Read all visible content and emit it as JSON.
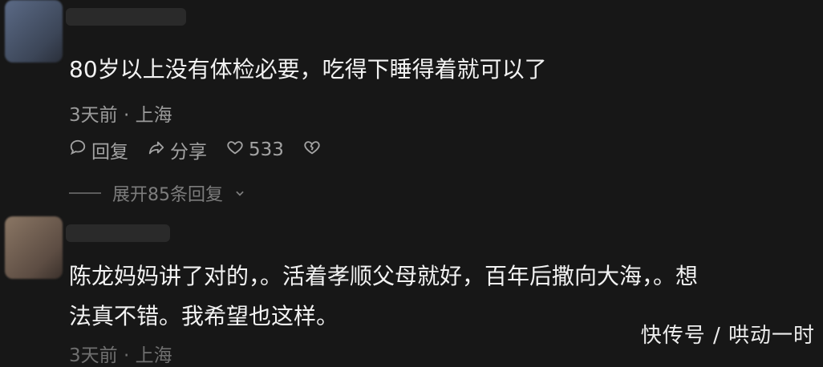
{
  "comments": [
    {
      "text": "80岁以上没有体检必要，吃得下睡得着就可以了",
      "meta": "3天前 · 上海",
      "actions": {
        "reply": "回复",
        "share": "分享",
        "likes": "533"
      },
      "expand": "展开85条回复"
    },
    {
      "text_lines": [
        "陈龙妈妈讲了对的，。活着孝顺父母就好，百年后撒向大海，。想",
        "法真不错。我希望也这样。"
      ],
      "meta_partial": "3天前 · 上海"
    }
  ],
  "watermark": "快传号 / 哄动一时",
  "icons": [
    "comment-icon",
    "share-icon",
    "heart-icon",
    "broken-heart-icon",
    "chevron-down-icon"
  ]
}
